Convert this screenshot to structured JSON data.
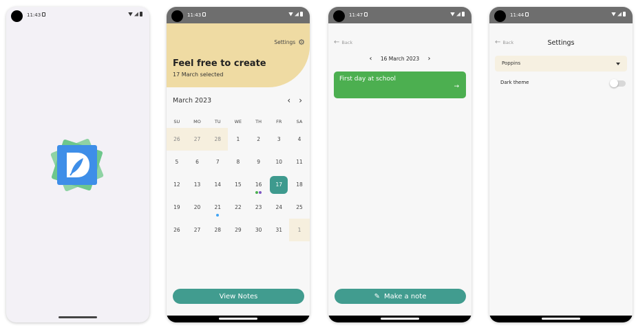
{
  "colors": {
    "teal": "#419c8f",
    "hero_yellow": "#efdba3",
    "note_green": "#4caf50",
    "logo_blue": "#3e8ee8",
    "dot_green": "#4caf50",
    "dot_purple": "#7e57c2",
    "dot_blue": "#42a5f5"
  },
  "splash": {
    "status_time": "11:43",
    "logo_icon": "diary-feather-logo"
  },
  "calendar_screen": {
    "status_time": "11:43",
    "settings_label": "Settings",
    "title": "Feel free to create",
    "subtitle": "17 March selected",
    "month_label": "March 2023",
    "prev_icon": "‹",
    "next_icon": "›",
    "weekdays": [
      "SU",
      "MO",
      "TU",
      "WE",
      "TH",
      "FR",
      "SA"
    ],
    "weeks": [
      [
        "26",
        "27",
        "28",
        "1",
        "2",
        "3",
        "4"
      ],
      [
        "5",
        "6",
        "7",
        "8",
        "9",
        "10",
        "11"
      ],
      [
        "12",
        "13",
        "14",
        "15",
        "16",
        "17",
        "18"
      ],
      [
        "19",
        "20",
        "21",
        "22",
        "23",
        "24",
        "25"
      ],
      [
        "26",
        "27",
        "28",
        "29",
        "30",
        "31",
        "1"
      ]
    ],
    "view_notes_label": "View Notes"
  },
  "day_screen": {
    "status_time": "11:47",
    "back_label": "Back",
    "date_label": "16 March 2023",
    "note_title": "First day at school",
    "make_note_label": "Make a note"
  },
  "settings_screen": {
    "status_time": "11:44",
    "back_label": "Back",
    "title": "Settings",
    "font_value": "Poppins",
    "dark_theme_label": "Dark theme",
    "dark_theme_on": false
  }
}
